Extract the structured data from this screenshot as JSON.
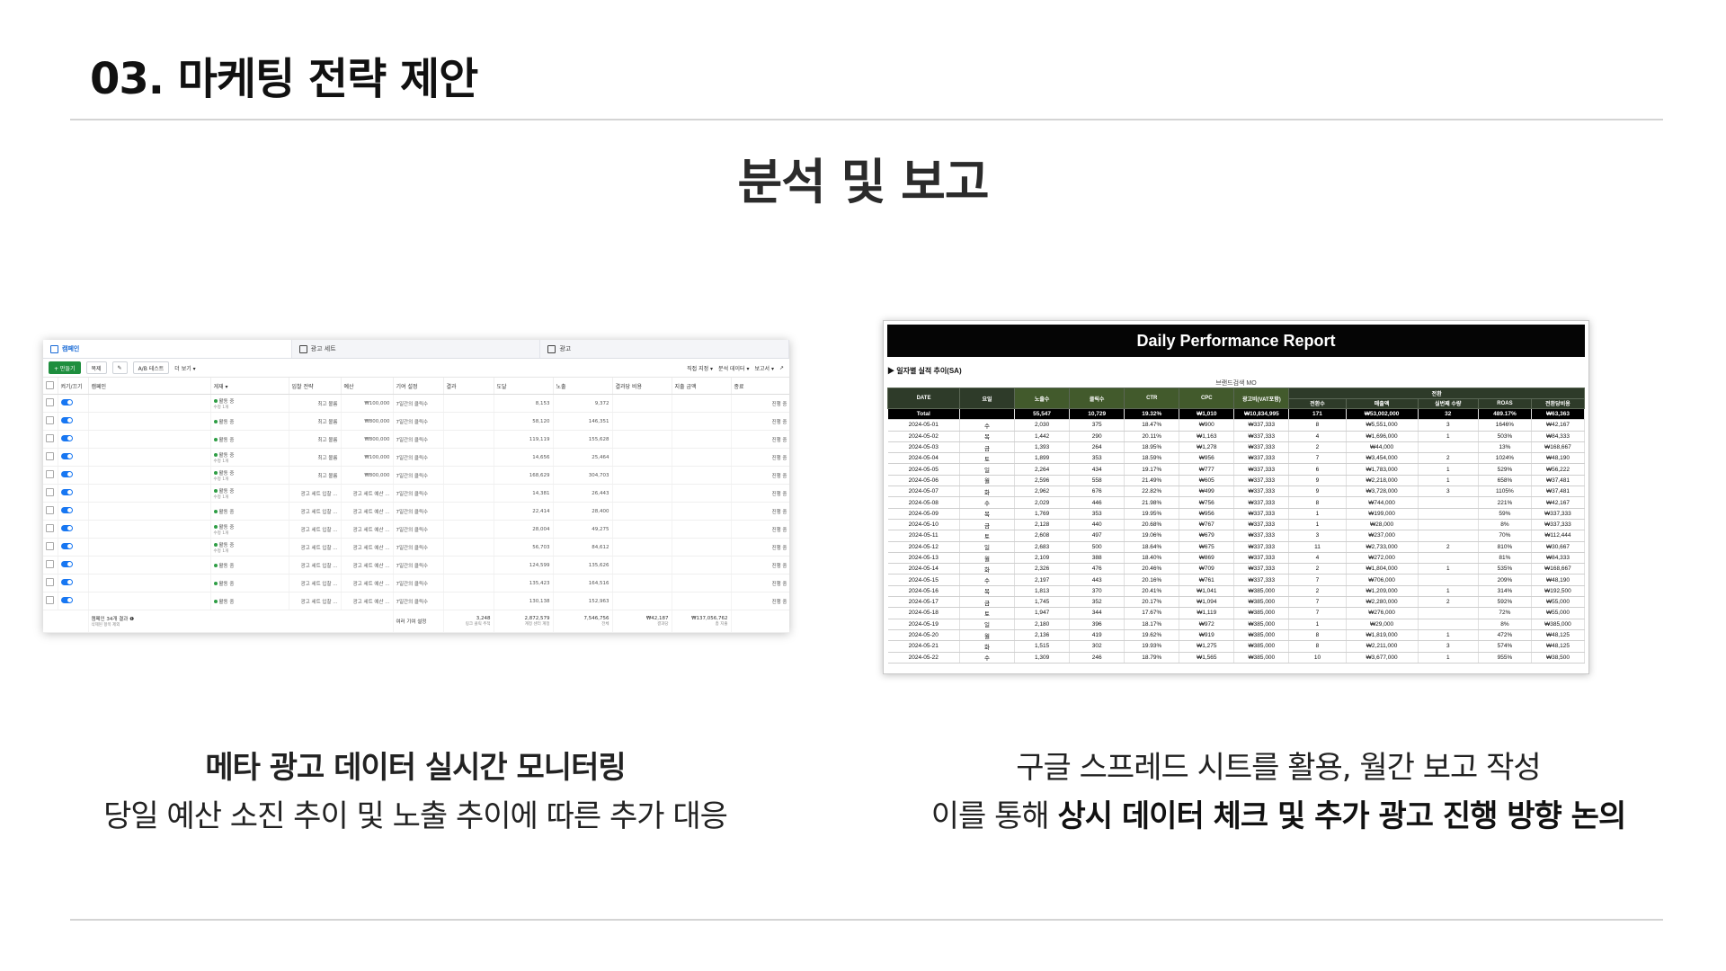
{
  "slide": {
    "title": "03. 마케팅 전략 제안",
    "heading": "분석 및 보고"
  },
  "left_caption": {
    "line1": "메타 광고 데이터 실시간 모니터링",
    "line2": "당일 예산 소진 추이 및 노출 추이에 따른 추가 대응"
  },
  "right_caption": {
    "line1": "구글 스프레드 시트를 활용, 월간 보고 작성",
    "line2_prefix": "이를 통해 ",
    "line2_bold": "상시 데이터 체크 및 추가 광고 진행 방향 논의"
  },
  "ads_manager": {
    "tabs": [
      "캠페인",
      "광고 세트",
      "광고"
    ],
    "toolbar": {
      "create": "+ 만들기",
      "duplicate": "복제",
      "edit": "✎",
      "ab_test": "A/B 테스트",
      "more": "더 보기 ▾",
      "columns": "직접 지정 ▾",
      "breakdown": "분석 데이터 ▾",
      "reports": "보고서 ▾"
    },
    "columns": [
      "",
      "켜기/끄기",
      "캠페인",
      "게재 ▾",
      "입찰 전략",
      "예산",
      "기여 설정",
      "결과",
      "도달",
      "노출",
      "결과당 비용",
      "지출 금액",
      "종료"
    ],
    "rows": [
      {
        "delivery": "활동 중",
        "sub": "수정 1개",
        "bid": "최고 볼륨",
        "budget": "₩100,000",
        "attr": "7일간의 클릭수",
        "reach": "8,153",
        "impr": "9,372",
        "end": "진행 중"
      },
      {
        "delivery": "활동 중",
        "sub": "",
        "bid": "최고 볼륨",
        "budget": "₩800,000",
        "attr": "7일간의 클릭수",
        "reach": "58,120",
        "impr": "146,351",
        "end": "진행 중"
      },
      {
        "delivery": "활동 중",
        "sub": "",
        "bid": "최고 볼륨",
        "budget": "₩800,000",
        "attr": "7일간의 클릭수",
        "reach": "119,119",
        "impr": "155,628",
        "end": "진행 중"
      },
      {
        "delivery": "활동 중",
        "sub": "수정 1개",
        "bid": "최고 볼륨",
        "budget": "₩100,000",
        "attr": "7일간의 클릭수",
        "reach": "14,656",
        "impr": "25,464",
        "end": "진행 중"
      },
      {
        "delivery": "활동 중",
        "sub": "수정 1개",
        "bid": "최고 볼륨",
        "budget": "₩800,000",
        "attr": "7일간의 클릭수",
        "reach": "168,629",
        "impr": "304,703",
        "end": "진행 중"
      },
      {
        "delivery": "활동 중",
        "sub": "수정 1개",
        "bid": "광고 세트 입찰 ...",
        "budget": "광고 세트 예산 ...",
        "attr": "7일간의 클릭수",
        "reach": "14,381",
        "impr": "26,443",
        "end": "진행 중"
      },
      {
        "delivery": "활동 중",
        "sub": "",
        "bid": "광고 세트 입찰 ...",
        "budget": "광고 세트 예산 ...",
        "attr": "7일간의 클릭수",
        "reach": "22,414",
        "impr": "28,400",
        "end": "진행 중"
      },
      {
        "delivery": "활동 중",
        "sub": "수정 1개",
        "bid": "광고 세트 입찰 ...",
        "budget": "광고 세트 예산 ...",
        "attr": "7일간의 클릭수",
        "reach": "28,004",
        "impr": "49,275",
        "end": "진행 중"
      },
      {
        "delivery": "활동 중",
        "sub": "수정 1개",
        "bid": "광고 세트 입찰 ...",
        "budget": "광고 세트 예산 ...",
        "attr": "7일간의 클릭수",
        "reach": "56,703",
        "impr": "84,612",
        "end": "진행 중"
      },
      {
        "delivery": "활동 중",
        "sub": "",
        "bid": "광고 세트 입찰 ...",
        "budget": "광고 세트 예산 ...",
        "attr": "7일간의 클릭수",
        "reach": "124,599",
        "impr": "135,626",
        "end": "진행 중"
      },
      {
        "delivery": "활동 중",
        "sub": "",
        "bid": "광고 세트 입찰 ...",
        "budget": "광고 세트 예산 ...",
        "attr": "7일간의 클릭수",
        "reach": "135,423",
        "impr": "164,516",
        "end": "진행 중"
      },
      {
        "delivery": "활동 중",
        "sub": "",
        "bid": "광고 세트 입찰 ...",
        "budget": "광고 세트 예산 ...",
        "attr": "7일간의 클릭수",
        "reach": "130,138",
        "impr": "152,963",
        "end": "진행 중"
      }
    ],
    "footer": {
      "campaigns": "캠페인 34개 결과 ❶",
      "campaigns_sub": "삭제된 항목 제외",
      "attr": "여러 기여 설정",
      "results": "3,248",
      "results_sub": "링크 클릭 추적",
      "reach": "2,872,579",
      "reach_sub": "계정 센터 계정",
      "impr": "7,546,756",
      "impr_sub": "전체",
      "cpr": "₩42,187",
      "cpr_sub": "결과당",
      "spend": "₩137,056,762",
      "spend_sub": "총 지출"
    }
  },
  "report": {
    "title": "Daily Performance Report",
    "section": "▶ 일자별 실적 추이(SA)",
    "brand": "브랜드검색 MO",
    "group_header": "전환",
    "headers": [
      "DATE",
      "요일",
      "노출수",
      "클릭수",
      "CTR",
      "CPC",
      "광고비(VAT포함)",
      "전환수",
      "매출액",
      "실번째 수량",
      "ROAS",
      "전환당비용"
    ],
    "total": [
      "Total",
      "",
      "55,547",
      "10,729",
      "19.32%",
      "₩1,010",
      "₩10,834,995",
      "171",
      "₩53,002,000",
      "32",
      "489.17%",
      "₩63,363"
    ],
    "rows": [
      [
        "2024-05-01",
        "수",
        "2,030",
        "375",
        "18.47%",
        "₩900",
        "₩337,333",
        "8",
        "₩5,551,000",
        "3",
        "1646%",
        "₩42,167"
      ],
      [
        "2024-05-02",
        "목",
        "1,442",
        "290",
        "20.11%",
        "₩1,163",
        "₩337,333",
        "4",
        "₩1,696,000",
        "1",
        "503%",
        "₩84,333"
      ],
      [
        "2024-05-03",
        "금",
        "1,393",
        "264",
        "18.95%",
        "₩1,278",
        "₩337,333",
        "2",
        "₩44,000",
        "",
        "13%",
        "₩168,667"
      ],
      [
        "2024-05-04",
        "토",
        "1,899",
        "353",
        "18.59%",
        "₩956",
        "₩337,333",
        "7",
        "₩3,454,000",
        "2",
        "1024%",
        "₩48,190"
      ],
      [
        "2024-05-05",
        "일",
        "2,264",
        "434",
        "19.17%",
        "₩777",
        "₩337,333",
        "6",
        "₩1,783,000",
        "1",
        "529%",
        "₩56,222"
      ],
      [
        "2024-05-06",
        "월",
        "2,596",
        "558",
        "21.49%",
        "₩605",
        "₩337,333",
        "9",
        "₩2,218,000",
        "1",
        "658%",
        "₩37,481"
      ],
      [
        "2024-05-07",
        "화",
        "2,962",
        "676",
        "22.82%",
        "₩499",
        "₩337,333",
        "9",
        "₩3,728,000",
        "3",
        "1105%",
        "₩37,481"
      ],
      [
        "2024-05-08",
        "수",
        "2,029",
        "446",
        "21.98%",
        "₩756",
        "₩337,333",
        "8",
        "₩744,000",
        "",
        "221%",
        "₩42,167"
      ],
      [
        "2024-05-09",
        "목",
        "1,769",
        "353",
        "19.95%",
        "₩956",
        "₩337,333",
        "1",
        "₩199,000",
        "",
        "59%",
        "₩337,333"
      ],
      [
        "2024-05-10",
        "금",
        "2,128",
        "440",
        "20.68%",
        "₩767",
        "₩337,333",
        "1",
        "₩28,000",
        "",
        "8%",
        "₩337,333"
      ],
      [
        "2024-05-11",
        "토",
        "2,608",
        "497",
        "19.06%",
        "₩679",
        "₩337,333",
        "3",
        "₩237,000",
        "",
        "70%",
        "₩112,444"
      ],
      [
        "2024-05-12",
        "일",
        "2,683",
        "500",
        "18.64%",
        "₩675",
        "₩337,333",
        "11",
        "₩2,733,000",
        "2",
        "810%",
        "₩30,667"
      ],
      [
        "2024-05-13",
        "월",
        "2,109",
        "388",
        "18.40%",
        "₩869",
        "₩337,333",
        "4",
        "₩272,000",
        "",
        "81%",
        "₩84,333"
      ],
      [
        "2024-05-14",
        "화",
        "2,326",
        "476",
        "20.46%",
        "₩709",
        "₩337,333",
        "2",
        "₩1,804,000",
        "1",
        "535%",
        "₩168,667"
      ],
      [
        "2024-05-15",
        "수",
        "2,197",
        "443",
        "20.16%",
        "₩761",
        "₩337,333",
        "7",
        "₩706,000",
        "",
        "209%",
        "₩48,190"
      ],
      [
        "2024-05-16",
        "목",
        "1,813",
        "370",
        "20.41%",
        "₩1,041",
        "₩385,000",
        "2",
        "₩1,209,000",
        "1",
        "314%",
        "₩192,500"
      ],
      [
        "2024-05-17",
        "금",
        "1,745",
        "352",
        "20.17%",
        "₩1,094",
        "₩385,000",
        "7",
        "₩2,280,000",
        "2",
        "592%",
        "₩55,000"
      ],
      [
        "2024-05-18",
        "토",
        "1,947",
        "344",
        "17.67%",
        "₩1,119",
        "₩385,000",
        "7",
        "₩276,000",
        "",
        "72%",
        "₩55,000"
      ],
      [
        "2024-05-19",
        "일",
        "2,180",
        "396",
        "18.17%",
        "₩972",
        "₩385,000",
        "1",
        "₩29,000",
        "",
        "8%",
        "₩385,000"
      ],
      [
        "2024-05-20",
        "월",
        "2,136",
        "419",
        "19.62%",
        "₩919",
        "₩385,000",
        "8",
        "₩1,819,000",
        "1",
        "472%",
        "₩48,125"
      ],
      [
        "2024-05-21",
        "화",
        "1,515",
        "302",
        "19.93%",
        "₩1,275",
        "₩385,000",
        "8",
        "₩2,211,000",
        "3",
        "574%",
        "₩48,125"
      ],
      [
        "2024-05-22",
        "수",
        "1,309",
        "246",
        "18.79%",
        "₩1,565",
        "₩385,000",
        "10",
        "₩3,677,000",
        "1",
        "955%",
        "₩38,500"
      ]
    ]
  }
}
